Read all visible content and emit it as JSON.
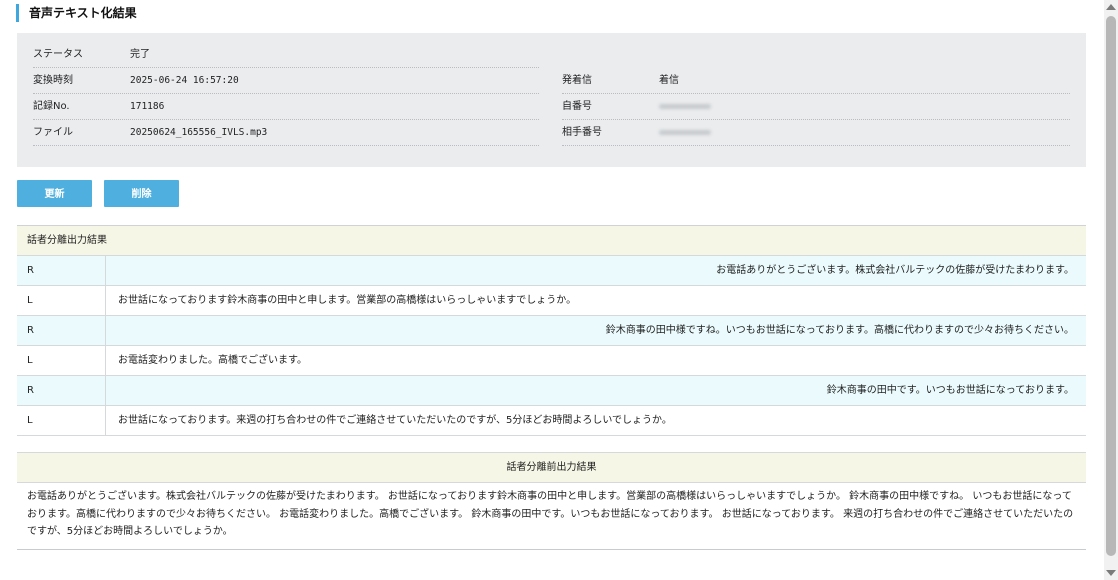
{
  "page": {
    "title": "音声テキスト化結果"
  },
  "info": {
    "status": {
      "label": "ステータス",
      "value": "完了"
    },
    "converted_at": {
      "label": "変換時刻",
      "value": "2025-06-24 16:57:20"
    },
    "record_no": {
      "label": "記録No.",
      "value": "171186"
    },
    "file": {
      "label": "ファイル",
      "value": "20250624_165556_IVLS.mp3"
    },
    "direction": {
      "label": "発着信",
      "value": "着信"
    },
    "own_number": {
      "label": "自番号"
    },
    "other_number": {
      "label": "相手番号"
    }
  },
  "buttons": {
    "update": "更新",
    "delete": "削除"
  },
  "diarization": {
    "title": "話者分離出力結果",
    "rows": [
      {
        "speaker": "R",
        "text": "お電話ありがとうございます。株式会社バルテックの佐藤が受けたまわります。"
      },
      {
        "speaker": "L",
        "text": "お世話になっております鈴木商事の田中と申します。営業部の高橋様はいらっしゃいますでしょうか。"
      },
      {
        "speaker": "R",
        "text": "鈴木商事の田中様ですね。いつもお世話になっております。高橋に代わりますので少々お待ちください。"
      },
      {
        "speaker": "L",
        "text": "お電話変わりました。高橋でございます。"
      },
      {
        "speaker": "R",
        "text": "鈴木商事の田中です。いつもお世話になっております。"
      },
      {
        "speaker": "L",
        "text": "お世話になっております。来週の打ち合わせの件でご連絡させていただいたのですが、5分ほどお時間よろしいでしょうか。"
      }
    ]
  },
  "pre_diarization": {
    "title": "話者分離前出力結果",
    "text": "お電話ありがとうございます。株式会社バルテックの佐藤が受けたまわります。 お世話になっております鈴木商事の田中と申します。営業部の高橋様はいらっしゃいますでしょうか。 鈴木商事の田中様ですね。 いつもお世話になっております。高橋に代わりますので少々お待ちください。 お電話変わりました。高橋でございます。 鈴木商事の田中です。いつもお世話になっております。 お世話になっております。 来週の打ち合わせの件でご連絡させていただいたのですが、5分ほどお時間よろしいでしょうか。"
  }
}
